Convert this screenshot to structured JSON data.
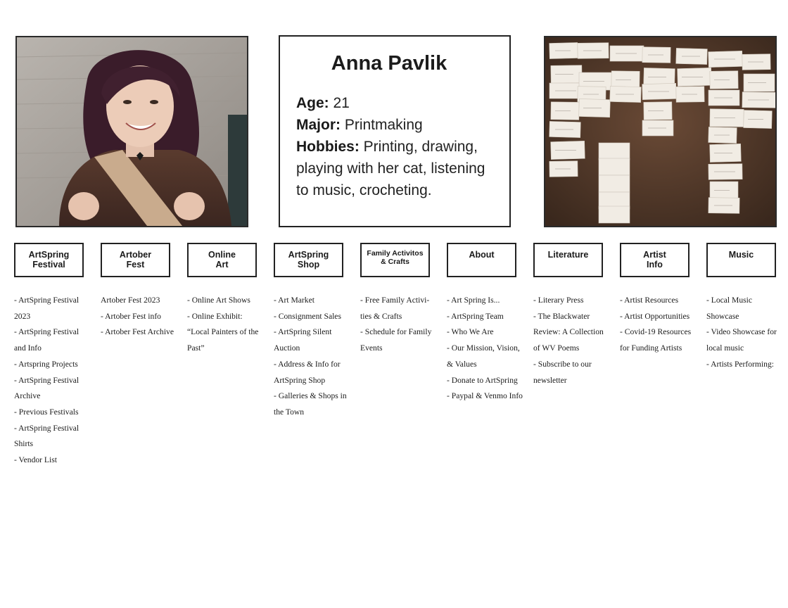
{
  "profile": {
    "name": "Anna Pavlik",
    "age_label": "Age:",
    "age_value": " 21",
    "major_label": "Major:",
    "major_value": " Printmaking",
    "hobbies_label": "Hobbies:",
    "hobbies_value": " Printing, drawing, playing with her cat, listening to music, crocheting."
  },
  "nav": [
    {
      "label": "ArtSpring Festival",
      "items": [
        "- ArtSpring Festival 2023",
        "- ArtSpring Festival and Info",
        "- Artspring Projects",
        "- ArtSpring Festival Archive",
        "- Previous Festivals",
        "- ArtSpring Festival Shirts",
        "- Vendor List"
      ]
    },
    {
      "label": "Artober Fest",
      "items": [
        "Artober Fest 2023",
        "- Artober Fest info",
        "- Artober Fest Archive"
      ]
    },
    {
      "label": "Online Art",
      "items": [
        "- Online Art Shows",
        "- Online Exhibit: “Local Painters of the Past”"
      ]
    },
    {
      "label": "ArtSpring Shop",
      "items": [
        "- Art Market",
        "- Consignment Sales",
        "- ArtSpring Silent Auction",
        "- Address & Info for ArtSpring Shop",
        "- Galleries & Shops in the Town"
      ]
    },
    {
      "label": "Family Activitos & Crafts",
      "items": [
        "- Free Family Activi- ties & Crafts",
        "- Schedule for Family Events"
      ]
    },
    {
      "label": "About",
      "items": [
        "- Art Spring Is...",
        "- ArtSpring Team",
        "- Who We Are",
        "- Our Mission, Vision, & Values",
        "- Donate to ArtSpring",
        "- Paypal & Venmo Info"
      ]
    },
    {
      "label": "Literature",
      "items": [
        "- Literary Press",
        "- The Blackwater Review: A Collection of WV Poems",
        "- Subscribe to our newsletter"
      ]
    },
    {
      "label": "Artist Info",
      "items": [
        "- Artist Resources",
        "- Artist Opportunities",
        "- Covid-19 Resources for Funding Artists"
      ]
    },
    {
      "label": "Music",
      "items": [
        "- Local Music Showcase",
        "- Video Showcase for local music",
        "- Artists Performing:"
      ]
    }
  ]
}
